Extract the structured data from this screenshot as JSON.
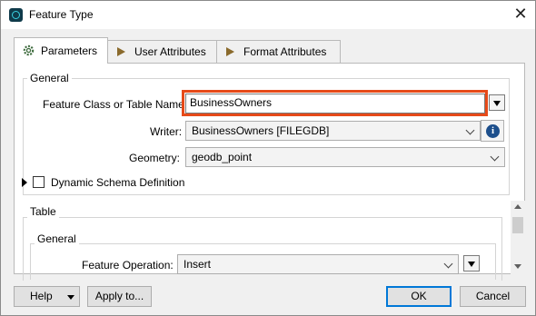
{
  "window": {
    "title": "Feature Type",
    "close_glyph": "✕"
  },
  "tabs": [
    {
      "label": "Parameters",
      "icon": "gear-icon",
      "active": true
    },
    {
      "label": "User Attributes",
      "icon": "arrow-icon",
      "active": false
    },
    {
      "label": "Format Attributes",
      "icon": "arrow-icon",
      "active": false
    }
  ],
  "general": {
    "group_label": "General",
    "feature_class_label": "Feature Class or Table Name:",
    "feature_class_value": "BusinessOwners",
    "writer_label": "Writer:",
    "writer_value": "BusinessOwners [FILEGDB]",
    "geometry_label": "Geometry:",
    "geometry_value": "geodb_point",
    "dynamic_schema_label": "Dynamic Schema Definition",
    "dynamic_schema_checked": false
  },
  "table": {
    "group_label": "Table",
    "sub_group_label": "General",
    "feature_operation_label": "Feature Operation:",
    "feature_operation_value": "Insert"
  },
  "buttons": {
    "help": "Help",
    "apply_to": "Apply to...",
    "ok": "OK",
    "cancel": "Cancel"
  },
  "colors": {
    "highlight": "#e64a19",
    "accent": "#0078d7"
  }
}
